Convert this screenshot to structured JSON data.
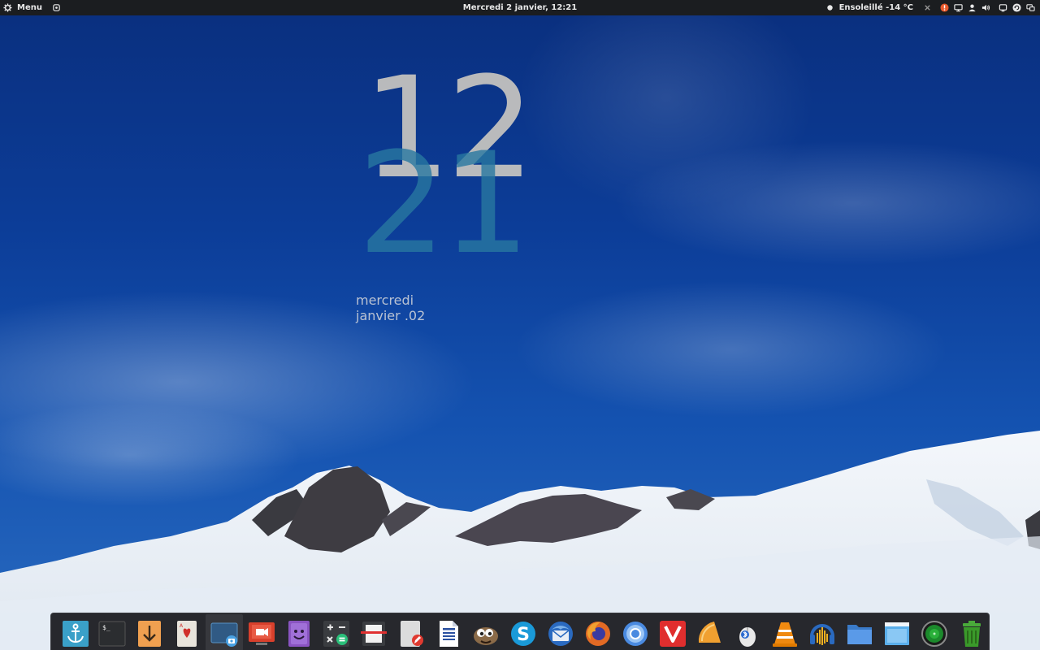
{
  "top_panel": {
    "menu_label": "Menu",
    "datetime": "Mercredi  2 janvier, 12:21",
    "weather": "Ensoleillé -14 °C"
  },
  "clock_widget": {
    "hours": "12",
    "minutes": "21",
    "day": "mercredi",
    "date": "janvier .02"
  },
  "dock": {
    "apps": [
      {
        "icon": "anchor-icon",
        "color": "#3aa0c8"
      },
      {
        "icon": "terminal-icon",
        "color": "#2b2d30"
      },
      {
        "icon": "download-icon",
        "color": "#f0a050"
      },
      {
        "icon": "cards-icon",
        "color": "#e8e4dc"
      },
      {
        "icon": "screenshot-icon",
        "color": "#1f4c7a"
      },
      {
        "icon": "screen-recorder-icon",
        "color": "#d8402c"
      },
      {
        "icon": "face-app-icon",
        "color": "#8a54c2"
      },
      {
        "icon": "calculator-icon",
        "color": "#3a3c40"
      },
      {
        "icon": "scanner-icon",
        "color": "#3a3c40"
      },
      {
        "icon": "text-editor-icon",
        "color": "#dcdcdc"
      },
      {
        "icon": "writer-document-icon",
        "color": "#ffffff"
      },
      {
        "icon": "gimp-icon",
        "color": "#8a6a48"
      },
      {
        "icon": "skype-icon",
        "color": "#1a9ad8"
      },
      {
        "icon": "thunderbird-icon",
        "color": "#2a6ac0"
      },
      {
        "icon": "firefox-icon",
        "color": "#e26a24"
      },
      {
        "icon": "chromium-icon",
        "color": "#4a8ae0"
      },
      {
        "icon": "vivaldi-icon",
        "color": "#e02e2e"
      },
      {
        "icon": "orange-slice-icon",
        "color": "#f0a030"
      },
      {
        "icon": "bluetooth-mouse-icon",
        "color": "#e8e8e8"
      },
      {
        "icon": "vlc-icon",
        "color": "#f08a10"
      },
      {
        "icon": "audacity-icon",
        "color": "#f0b020"
      },
      {
        "icon": "folder-icon",
        "color": "#4a90d8"
      },
      {
        "icon": "window-icon",
        "color": "#5aaeea"
      },
      {
        "icon": "radar-icon",
        "color": "#1c8a2c"
      },
      {
        "icon": "trash-icon",
        "color": "#4aaa3a"
      }
    ]
  }
}
